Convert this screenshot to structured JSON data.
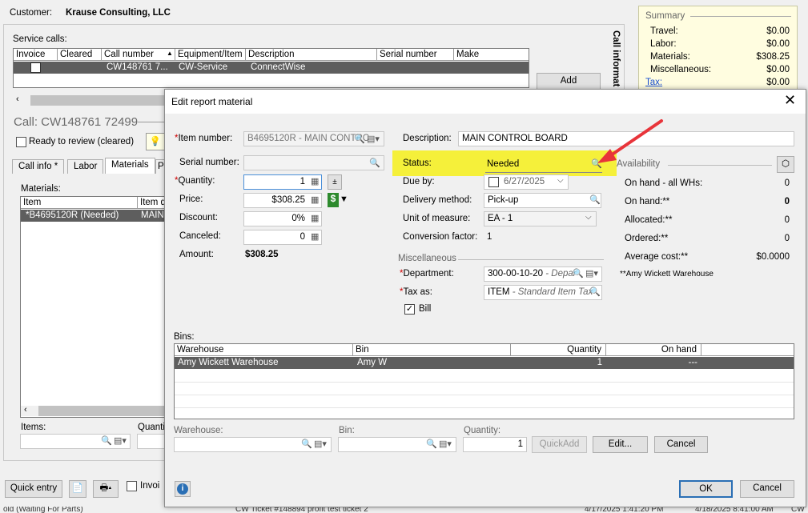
{
  "background": {
    "customer_label": "Customer:",
    "customer_name": "Krause Consulting, LLC",
    "service_calls_label": "Service calls:",
    "service_calls_columns": [
      "Invoice",
      "Cleared",
      "Call number",
      "Equipment/Item",
      "Description",
      "Serial number",
      "Make"
    ],
    "service_call_row": {
      "call_number": "CW148761 7...",
      "equipment": "CW-Service",
      "description": "ConnectWise"
    },
    "add_button": "Add",
    "call_title": "Call: CW148761 72499",
    "ready_to_review": "Ready to review (cleared)",
    "tabs": [
      "Call info *",
      "Labor",
      "Materials",
      "P"
    ],
    "materials_label": "Materials:",
    "materials_columns": [
      "Item",
      "Item d"
    ],
    "material_row": {
      "item": "*B4695120R (Needed)",
      "desc": "MAIN"
    },
    "items_label": "Items:",
    "quantity_label_cut": "Quanti",
    "quick_entry": "Quick entry",
    "invoice_cut": "Invoi",
    "side_panel_title": "Call informat",
    "status_bar": [
      "old (Waiting For Parts)",
      "CW Ticket #148894 profit test ticket 2",
      "4/17/2025 1:41:20 PM",
      "4/18/2025 8:41:00 AM",
      "CW"
    ]
  },
  "summary": {
    "title": "Summary",
    "rows": [
      {
        "label": "Travel:",
        "value": "$0.00"
      },
      {
        "label": "Labor:",
        "value": "$0.00"
      },
      {
        "label": "Materials:",
        "value": "$308.25"
      },
      {
        "label": "Miscellaneous:",
        "value": "$0.00"
      },
      {
        "label": "Tax:",
        "value": "$0.00"
      }
    ]
  },
  "dialog": {
    "title": "Edit report material",
    "item_number_label": "Item number:",
    "item_number_value": "B4695120R - MAIN CONTRC",
    "serial_label": "Serial number:",
    "quantity_label": "Quantity:",
    "quantity_value": "1",
    "price_label": "Price:",
    "price_value": "$308.25",
    "discount_label": "Discount:",
    "discount_value": "0%",
    "canceled_label": "Canceled:",
    "canceled_value": "0",
    "amount_label": "Amount:",
    "amount_value": "$308.25",
    "description_label": "Description:",
    "description_value": "MAIN CONTROL BOARD",
    "status_label": "Status:",
    "status_value": "Needed",
    "dueby_label": "Due by:",
    "dueby_value": "6/27/2025",
    "delivery_label": "Delivery method:",
    "delivery_value": "Pick-up",
    "uom_label": "Unit of measure:",
    "uom_value": "EA - 1",
    "conversion_label": "Conversion factor:",
    "conversion_value": "1",
    "misc_label": "Miscellaneous",
    "department_label": "Department:",
    "department_value": "300-00-10-20",
    "department_desc": "- Depar",
    "taxas_label": "Tax as:",
    "taxas_value": "ITEM",
    "taxas_desc": "- Standard Item Tax",
    "bill_label": "Bill",
    "availability": {
      "title": "Availability",
      "rows": [
        {
          "label": "On hand - all WHs:",
          "value": "0"
        },
        {
          "label": "On hand:**",
          "value": "0"
        },
        {
          "label": "Allocated:**",
          "value": "0"
        },
        {
          "label": "Ordered:**",
          "value": "0"
        },
        {
          "label": "Average cost:**",
          "value": "$0.0000"
        }
      ],
      "note": "**Amy Wickett Warehouse"
    },
    "bins_label": "Bins:",
    "bins_columns": [
      "Warehouse",
      "Bin",
      "Quantity",
      "On hand"
    ],
    "bins_row": {
      "warehouse": "Amy Wickett Warehouse",
      "bin": "Amy W",
      "quantity": "1",
      "onhand": "---"
    },
    "warehouse_label": "Warehouse:",
    "bin_label": "Bin:",
    "quantity2_label": "Quantity:",
    "quantity2_value": "1",
    "quickadd": "QuickAdd",
    "edit": "Edit...",
    "cancel_small": "Cancel",
    "ok": "OK",
    "cancel": "Cancel"
  },
  "colors": {
    "highlight": "#f5f03a",
    "arrow": "#e8343a",
    "selected_row": "#5e5e5e"
  },
  "icons": [
    "search-icon",
    "item-lookup-icon",
    "calculator-icon",
    "plus-minus-icon",
    "dollar-icon",
    "dropdown-icon",
    "calendar-icon",
    "box-icon",
    "info-icon",
    "close-icon"
  ]
}
